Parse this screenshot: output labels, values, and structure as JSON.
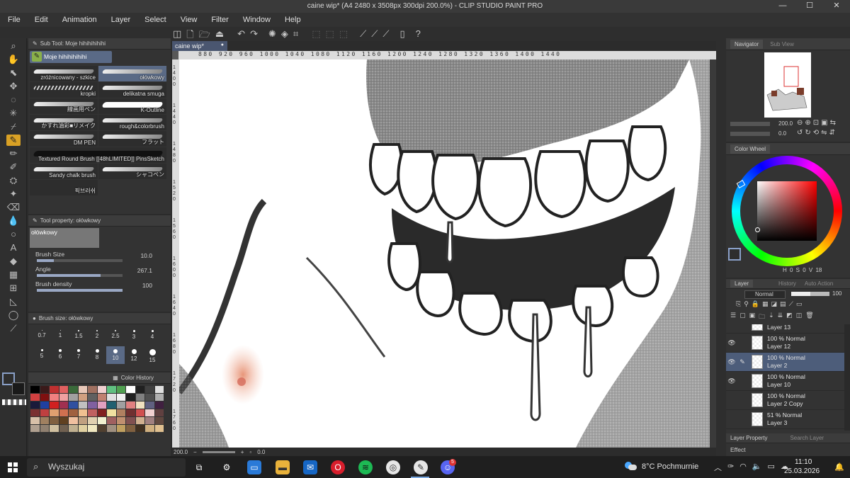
{
  "window": {
    "title": "caine wip* (A4 2480 x 3508px 300dpi 200.0%) - CLIP STUDIO PAINT PRO",
    "controls": [
      "—",
      "☐",
      "✕"
    ]
  },
  "menu": [
    "File",
    "Edit",
    "Animation",
    "Layer",
    "Select",
    "View",
    "Filter",
    "Window",
    "Help"
  ],
  "subtool": {
    "header": "Sub Tool: Moje hihihihihihi",
    "group_tab": "Moje hihihihihihi",
    "brushes": [
      "zróżnicowany - szkice",
      "ołówkowy",
      "kropki",
      "delikatna smuga",
      "線画用ペン",
      "K-Outline",
      "かすれ油彩■リメイク",
      "rough&colorbrush",
      "DM PEN",
      "フラット",
      "Textured Round Brush [[48hLIMITED]] PinsSketch",
      "",
      "Sandy chalk brush",
      "シャコペン",
      "픽브러쉬",
      ""
    ]
  },
  "tool_property": {
    "header": "Tool property: ołówkowy",
    "preview_label": "ołówkowy",
    "brush_size_label": "Brush Size",
    "brush_size": "10.0",
    "angle_label": "Angle",
    "angle": "267.1",
    "density_label": "Brush density",
    "density": "100"
  },
  "brush_size_panel": {
    "header": "Brush size: ołówkowy",
    "sizes": [
      "0.7",
      "1",
      "1.5",
      "2",
      "2.5",
      "3",
      "4",
      "5",
      "6",
      "7",
      "8",
      "10",
      "12",
      "15"
    ],
    "selected": "10"
  },
  "color_history": {
    "header": "Color History",
    "colors": [
      "#000000",
      "#3a1a1a",
      "#c03030",
      "#e06060",
      "#3a6a3a",
      "#e8c8b8",
      "#a07060",
      "#f0d0d0",
      "#60c080",
      "#50a050",
      "#ffffff",
      "#202020",
      "#404040",
      "#e0e0e0",
      "#d04040",
      "#801010",
      "#f08080",
      "#f0a0a0",
      "#a0a0a0",
      "#d0a080",
      "#606060",
      "#c08070",
      "#e0e0e0",
      "#f0f0f0",
      "#202020",
      "#808080",
      "#505050",
      "#b0b0b0",
      "#1a1a3a",
      "#2040a0",
      "#d02020",
      "#a03050",
      "#3050a0",
      "#c0c0c0",
      "#8060a0",
      "#e0a0c0",
      "#206070",
      "#a0a0a0",
      "#e08080",
      "#f0e0c0",
      "#606080",
      "#402040",
      "#7a3030",
      "#c04040",
      "#e0a070",
      "#d07050",
      "#a06040",
      "#f0c090",
      "#c06060",
      "#802020",
      "#f0e0a0",
      "#b08060",
      "#703030",
      "#d05050",
      "#f0d0d0",
      "#604040",
      "#d8c0a8",
      "#a08060",
      "#806040",
      "#604020",
      "#f0c0a0",
      "#c0a080",
      "#e0d0b0",
      "#f0f0d0",
      "#a06060",
      "#c09070",
      "#805050",
      "#d0b090",
      "#a08080",
      "#604840",
      "#b0a090",
      "#908070",
      "#d0c0a0",
      "#706050",
      "#c0b090",
      "#e0d0a0",
      "#f0e8c0",
      "#504030",
      "#a09080",
      "#c0a060",
      "#806040",
      "#403020",
      "#d0b080",
      "#e0c090"
    ]
  },
  "canvas": {
    "tab_label": "caine wip*",
    "ruler_h": "880  920  960  1000  1040  1080  1120  1160  1200  1240  1280  1320  1360  1400  1440",
    "ruler_v": [
      "1400",
      "1440",
      "1480",
      "1520",
      "1560",
      "1600",
      "1640",
      "1680",
      "1720",
      "1760"
    ],
    "status_zoom": "200.0",
    "status_rotate": "0.0"
  },
  "navigator": {
    "tab1": "Navigator",
    "tab2": "Sub View",
    "zoom": "200.0",
    "rotate": "0.0"
  },
  "color_wheel": {
    "tab": "Color Wheel",
    "readout": "H 0  S 0  V 18"
  },
  "layers": {
    "tabs": [
      "Layer",
      "History",
      "Auto Action"
    ],
    "blend_mode": "Normal",
    "opacity": "100",
    "items": [
      {
        "opacity": "",
        "name": "Layer 13",
        "visible": false,
        "selected": false
      },
      {
        "opacity": "100 % Normal",
        "name": "Layer 12",
        "visible": true,
        "selected": false
      },
      {
        "opacity": "100 % Normal",
        "name": "Layer 2",
        "visible": true,
        "selected": true
      },
      {
        "opacity": "100 % Normal",
        "name": "Layer 10",
        "visible": true,
        "selected": false
      },
      {
        "opacity": "100 % Normal",
        "name": "Layer 2 Copy",
        "visible": false,
        "selected": false
      },
      {
        "opacity": "51 % Normal",
        "name": "Layer 3",
        "visible": false,
        "selected": false
      }
    ],
    "footer_tab1": "Layer Property",
    "footer_tab2": "Search Layer",
    "effect_label": "Effect"
  },
  "taskbar": {
    "search_placeholder": "Wyszukaj",
    "weather": "8°C  Pochmurnie",
    "time": "11:10",
    "date": "25.03.2026",
    "badge": "5"
  },
  "colors": {
    "accent_tool": "#d9a125",
    "selected_row": "#4d5d7a",
    "panel_bg": "#333333"
  }
}
